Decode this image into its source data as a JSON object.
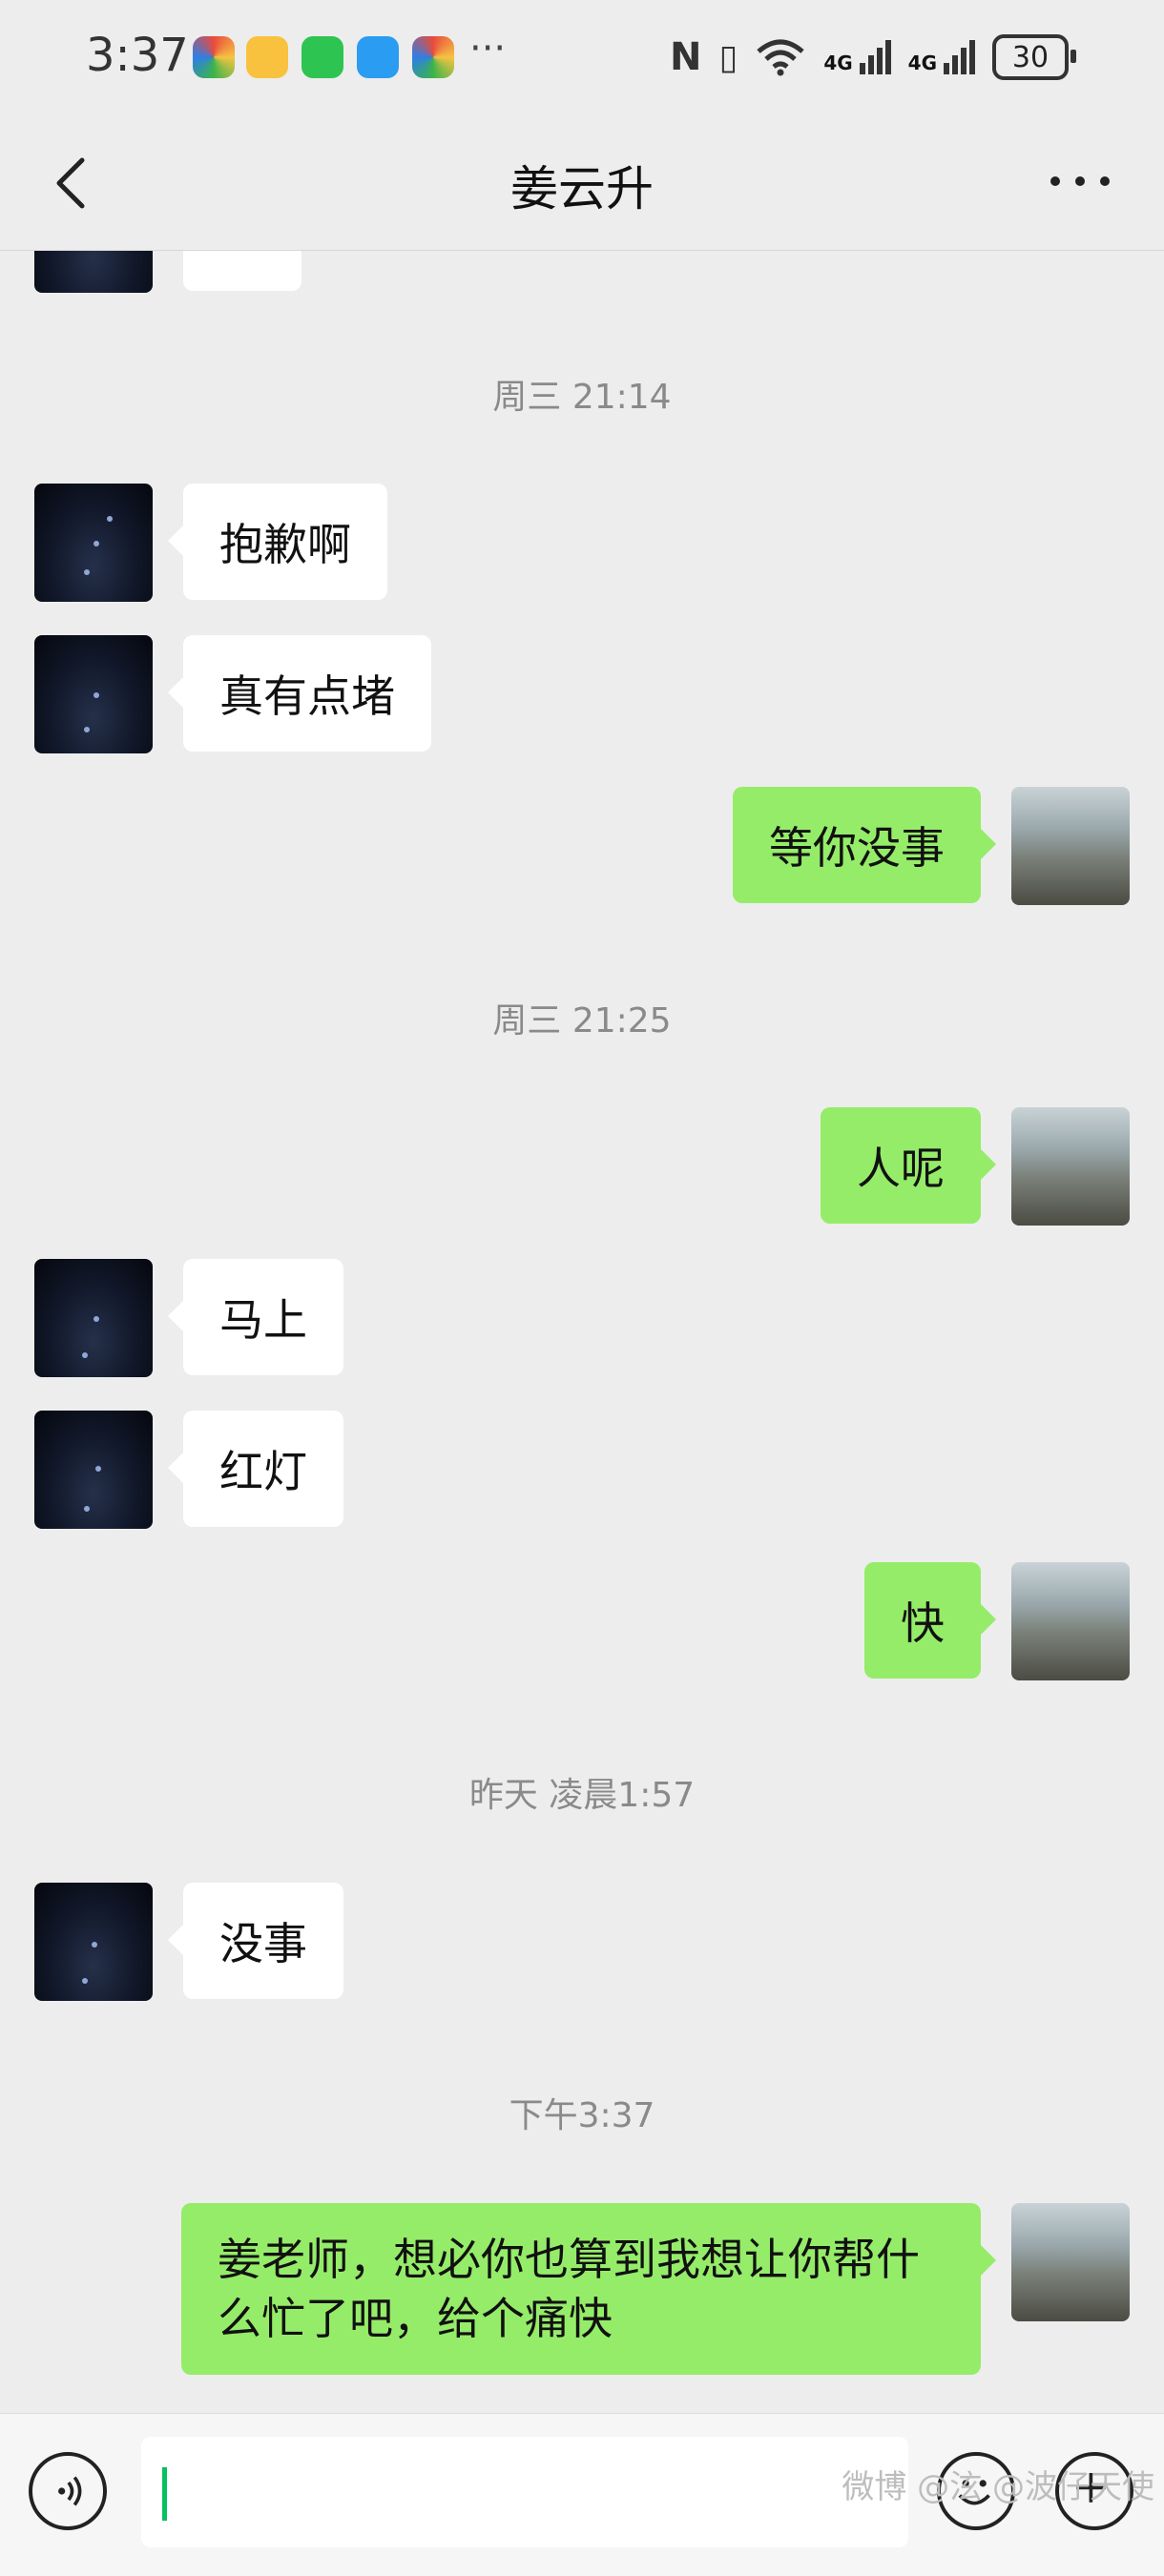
{
  "status_bar": {
    "time": "3:37",
    "more_dots": "···",
    "network_1": "4G",
    "network_2": "4G",
    "battery": "30"
  },
  "header": {
    "title": "姜云升"
  },
  "messages": [
    {
      "type": "timestamp",
      "text": "周三 21:14"
    },
    {
      "side": "left",
      "text": "抱歉啊"
    },
    {
      "side": "left",
      "text": "真有点堵"
    },
    {
      "side": "right",
      "text": "等你没事"
    },
    {
      "type": "timestamp",
      "text": "周三 21:25"
    },
    {
      "side": "right",
      "text": "人呢"
    },
    {
      "side": "left",
      "text": "马上"
    },
    {
      "side": "left",
      "text": "红灯"
    },
    {
      "side": "right",
      "text": "快"
    },
    {
      "type": "timestamp",
      "text": "昨天 凌晨1:57"
    },
    {
      "side": "left",
      "text": "没事"
    },
    {
      "type": "timestamp",
      "text": "下午3:37"
    },
    {
      "side": "right",
      "text": "姜老师，想必你也算到我想让你帮什么忙了吧，给个痛快"
    }
  ],
  "input": {
    "value": ""
  },
  "watermark": "微博 @泫 @波仔天使",
  "colors": {
    "background": "#ededed",
    "bubble_sent": "#95ec69",
    "bubble_received": "#ffffff",
    "caret": "#07c160"
  }
}
